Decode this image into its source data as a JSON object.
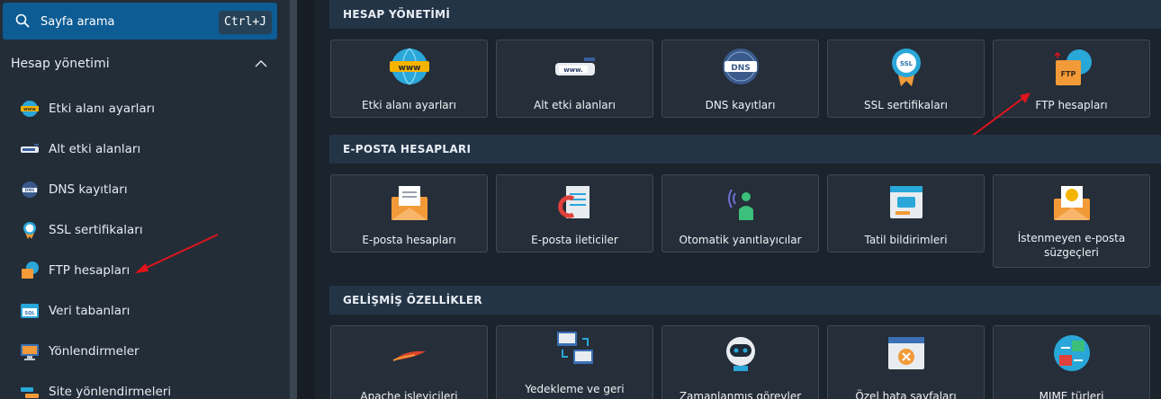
{
  "search": {
    "label": "Sayfa arama",
    "shortcut": "Ctrl+J"
  },
  "sidebar": {
    "section_title": "Hesap yönetimi",
    "items": [
      {
        "label": "Etki alanı ayarları",
        "icon": "www-globe-icon"
      },
      {
        "label": "Alt etki alanları",
        "icon": "www-bar-icon"
      },
      {
        "label": "DNS kayıtları",
        "icon": "dns-globe-icon"
      },
      {
        "label": "SSL sertifikaları",
        "icon": "ssl-badge-icon"
      },
      {
        "label": "FTP hesapları",
        "icon": "ftp-folder-icon"
      },
      {
        "label": "Veri tabanları",
        "icon": "sql-icon"
      },
      {
        "label": "Yönlendirmeler",
        "icon": "redirect-icon"
      },
      {
        "label": "Site yönlendirmeleri",
        "icon": "site-redirect-icon"
      }
    ]
  },
  "groups": [
    {
      "title": "HESAP YÖNETİMİ",
      "cards": [
        {
          "label": "Etki alanı ayarları"
        },
        {
          "label": "Alt etki alanları"
        },
        {
          "label": "DNS kayıtları"
        },
        {
          "label": "SSL sertifikaları"
        },
        {
          "label": "FTP hesapları"
        }
      ]
    },
    {
      "title": "E-POSTA HESAPLARI",
      "cards": [
        {
          "label": "E-posta hesapları"
        },
        {
          "label": "E-posta ileticiler"
        },
        {
          "label": "Otomatik yanıtlayıcılar"
        },
        {
          "label": "Tatil bildirimleri"
        },
        {
          "label": "İstenmeyen e-posta süzgeçleri"
        }
      ]
    },
    {
      "title": "GELİŞMİŞ ÖZELLİKLER",
      "cards": [
        {
          "label": "Apache işleyicileri"
        },
        {
          "label": "Yedekleme ve geri"
        },
        {
          "label": "Zamanlanmış görevler"
        },
        {
          "label": "Özel hata sayfaları"
        },
        {
          "label": "MIME türleri"
        }
      ]
    }
  ],
  "colors": {
    "accent": "#0d5c94",
    "annotation_arrow": "#e0141b"
  }
}
